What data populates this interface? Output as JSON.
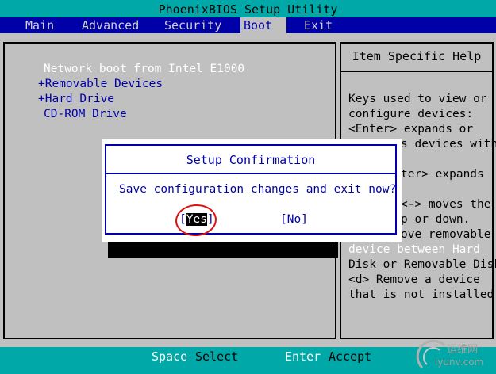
{
  "title": "PhoenixBIOS Setup Utility",
  "menu": {
    "items": [
      "Main",
      "Advanced",
      "Security",
      "Boot",
      "Exit"
    ],
    "active": "Boot"
  },
  "boot": {
    "items": [
      "Network boot from Intel E1000",
      "+Removable Devices",
      "+Hard Drive",
      "CD-ROM Drive"
    ]
  },
  "help": {
    "title": "Item Specific Help",
    "lines": [
      "Keys used to view or",
      "configure devices:",
      "<Enter> expands or",
      "s devices with",
      "ter> expands",
      "<-> moves the",
      "p or down.",
      "ove removable",
      "device between Hard",
      "Disk or Removable Disk",
      "<d> Remove a device",
      "that is not installed."
    ]
  },
  "dialog": {
    "title": "Setup Confirmation",
    "message": "Save configuration changes and exit now?",
    "yes_open": "[",
    "yes_label": "Yes",
    "yes_close": "]",
    "no_label": "[No]"
  },
  "status": {
    "key1": "Space",
    "action1": "Select",
    "key2": "Enter",
    "action2": "Accept"
  },
  "watermark": {
    "line1": "运维网",
    "line2": "iyunv.com"
  },
  "colors": {
    "menu_bar": "#0000a8",
    "title_bar": "#00a8a8",
    "panel": "#c0c0c0",
    "annotation": "#e01010"
  }
}
